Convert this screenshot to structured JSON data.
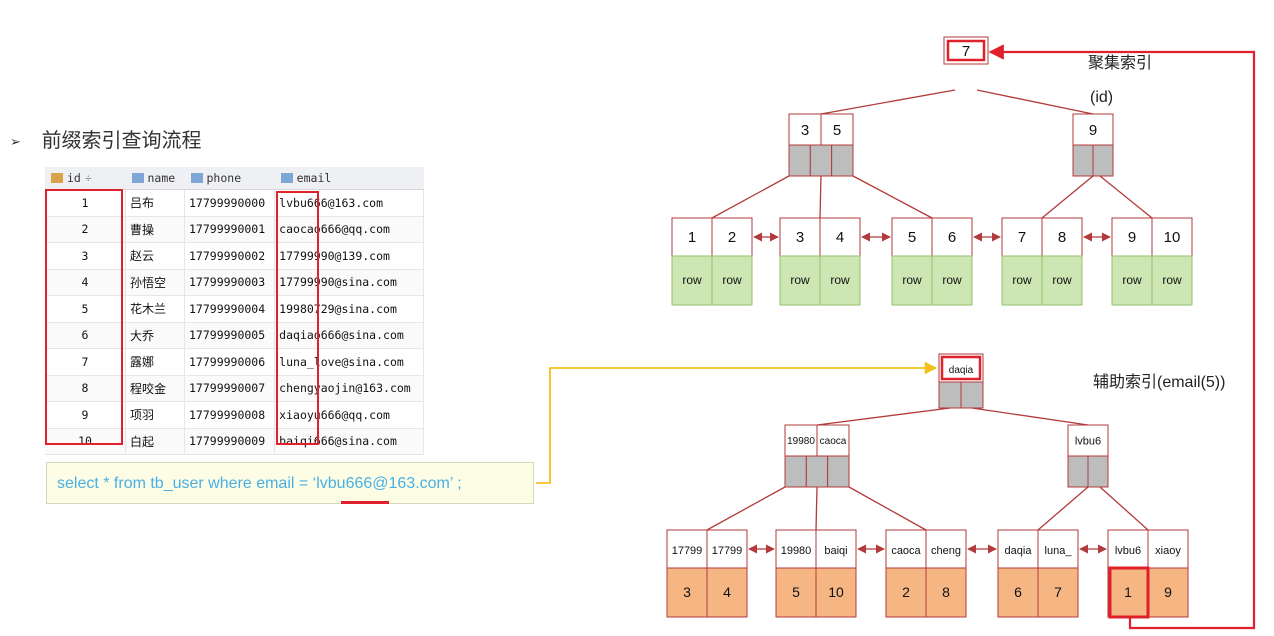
{
  "heading": {
    "bullet": "➢",
    "title": "前缀索引查询流程"
  },
  "table": {
    "columns": [
      "id",
      "name",
      "phone",
      "email"
    ],
    "rows": [
      {
        "id": "1",
        "name": "吕布",
        "phone": "17799990000",
        "email": "lvbu666@163.com"
      },
      {
        "id": "2",
        "name": "曹操",
        "phone": "17799990001",
        "email": "caocao666@qq.com"
      },
      {
        "id": "3",
        "name": "赵云",
        "phone": "17799990002",
        "email": "17799990@139.com"
      },
      {
        "id": "4",
        "name": "孙悟空",
        "phone": "17799990003",
        "email": "17799990@sina.com"
      },
      {
        "id": "5",
        "name": "花木兰",
        "phone": "17799990004",
        "email": "19980729@sina.com"
      },
      {
        "id": "6",
        "name": "大乔",
        "phone": "17799990005",
        "email": "daqiao666@sina.com"
      },
      {
        "id": "7",
        "name": "露娜",
        "phone": "17799990006",
        "email": "luna_love@sina.com"
      },
      {
        "id": "8",
        "name": "程咬金",
        "phone": "17799990007",
        "email": "chengyaojin@163.com"
      },
      {
        "id": "9",
        "name": "项羽",
        "phone": "17799990008",
        "email": "xiaoyu666@qq.com"
      },
      {
        "id": "10",
        "name": "白起",
        "phone": "17799990009",
        "email": "baiqi666@sina.com"
      }
    ]
  },
  "sql": "select * from tb_user where email = ‘lvbu666@163.com’ ;",
  "clustered": {
    "title": "聚集索引",
    "subtitle": "(id)",
    "root": [
      "7"
    ],
    "level1": [
      [
        "3",
        "5"
      ],
      [
        "9"
      ]
    ],
    "leaves": [
      [
        "1",
        "2"
      ],
      [
        "3",
        "4"
      ],
      [
        "5",
        "6"
      ],
      [
        "7",
        "8"
      ],
      [
        "9",
        "10"
      ]
    ],
    "leaf_value": "row"
  },
  "secondary": {
    "title": "辅助索引(email(5))",
    "root": [
      "daqia"
    ],
    "level1": [
      [
        "19980",
        "caoca"
      ],
      [
        "lvbu6"
      ]
    ],
    "leaves": [
      {
        "keys": [
          "17799",
          "17799"
        ],
        "ids": [
          "3",
          "4"
        ]
      },
      {
        "keys": [
          "19980",
          "baiqi"
        ],
        "ids": [
          "5",
          "10"
        ]
      },
      {
        "keys": [
          "caoca",
          "cheng"
        ],
        "ids": [
          "2",
          "8"
        ]
      },
      {
        "keys": [
          "daqia",
          "luna_"
        ],
        "ids": [
          "6",
          "7"
        ]
      },
      {
        "keys": [
          "lvbu6",
          "xiaoy"
        ],
        "ids": [
          "1",
          "9"
        ]
      }
    ]
  },
  "colors": {
    "red": "#e0202a",
    "node_border": "#b23a3a",
    "pointer_gray": "#bdbdbd",
    "row_green": "#cde6b3",
    "row_green_border": "#93c26b",
    "id_orange": "#f6b684",
    "arrow_yellow": "#f2c01b",
    "sql_blue": "#49b0e4"
  }
}
